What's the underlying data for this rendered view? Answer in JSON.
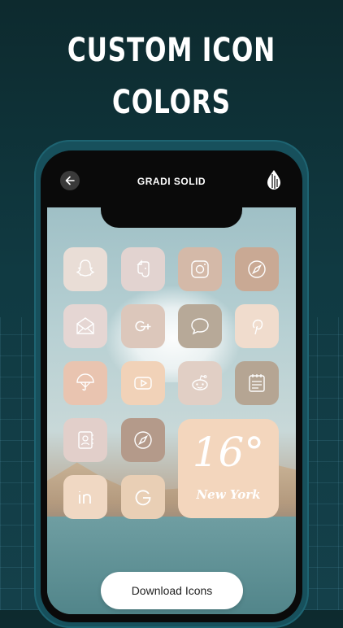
{
  "headline": {
    "line1": "CUSTOM ICON",
    "line2": "COLORS"
  },
  "top_bar": {
    "title": "GRADI SOLID",
    "back_icon": "arrow-left-icon",
    "theme_icon": "drop-icon"
  },
  "apps": [
    {
      "name": "snapchat",
      "icon": "snapchat-icon",
      "color": "#e9ddd6"
    },
    {
      "name": "evernote",
      "icon": "evernote-icon",
      "color": "#e2d3d0"
    },
    {
      "name": "instagram",
      "icon": "instagram-icon",
      "color": "#d4b9a8"
    },
    {
      "name": "safari",
      "icon": "compass-icon",
      "color": "#c9a994"
    },
    {
      "name": "mail",
      "icon": "mail-icon",
      "color": "#e5d6d3"
    },
    {
      "name": "google-plus",
      "icon": "google-plus-icon",
      "color": "#dcc7bb"
    },
    {
      "name": "messages",
      "icon": "chat-icon",
      "color": "#b7a998"
    },
    {
      "name": "pinterest",
      "icon": "pinterest-icon",
      "color": "#f0dccd"
    },
    {
      "name": "weather",
      "icon": "umbrella-icon",
      "color": "#e9c4b0"
    },
    {
      "name": "youtube",
      "icon": "play-icon",
      "color": "#f1d2b8"
    },
    {
      "name": "reddit",
      "icon": "reddit-icon",
      "color": "#e1cfc5"
    },
    {
      "name": "notes",
      "icon": "notepad-icon",
      "color": "#b5a593"
    },
    {
      "name": "contacts",
      "icon": "contacts-icon",
      "color": "#e2cfca"
    },
    {
      "name": "compass",
      "icon": "compass-icon",
      "color": "#b49a8a"
    },
    {
      "name": "linkedin",
      "icon": "linkedin-icon",
      "color": "#f0d8c3"
    },
    {
      "name": "google",
      "icon": "google-icon",
      "color": "#e9cfb5"
    }
  ],
  "widget": {
    "temperature": "16°",
    "city": "New York",
    "color": "#f3d6bd"
  },
  "download_button": {
    "label": "Download Icons"
  }
}
